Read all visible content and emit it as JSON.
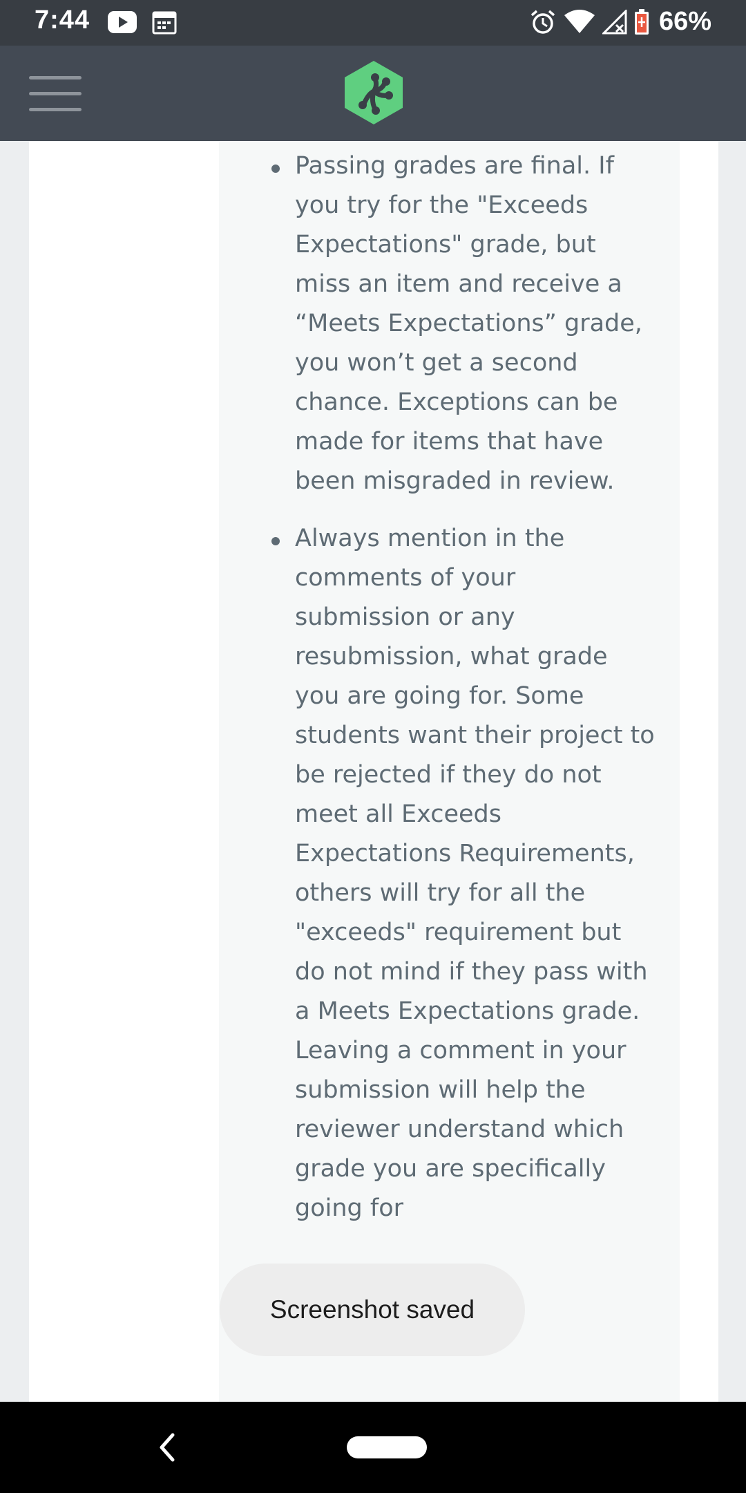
{
  "status_bar": {
    "time": "7:44",
    "battery_percent": "66%",
    "left_icons": [
      "youtube-icon",
      "calendar-icon"
    ],
    "right_icons": [
      "alarm-icon",
      "wifi-icon",
      "signal-icon",
      "battery-icon"
    ]
  },
  "header": {
    "menu_icon": "hamburger-menu-icon",
    "logo_icon": "treehouse-logo-icon",
    "brand_color": "#5fcf80"
  },
  "content": {
    "bullets": [
      "Passing grades are final. If you try for the \"Exceeds Expectations\" grade, but miss an item and receive a “Meets Expectations” grade, you won’t get a second chance. Exceptions can be made for items that have been misgraded in review.",
      "Always mention in the comments of your submission or any resubmission, what grade you are going for. Some students want their project to be rejected if they do not meet all Exceeds Expectations Requirements, others will try for all the \"exceeds\" requirement but do not mind if they pass with a Meets Expectations grade. Leaving a comment in your submission will help the reviewer understand which grade you are specifically going for"
    ]
  },
  "toast": {
    "message": "Screenshot saved"
  },
  "nav_bar": {
    "back_icon": "back-chevron-icon",
    "home_icon": "home-pill-icon"
  }
}
